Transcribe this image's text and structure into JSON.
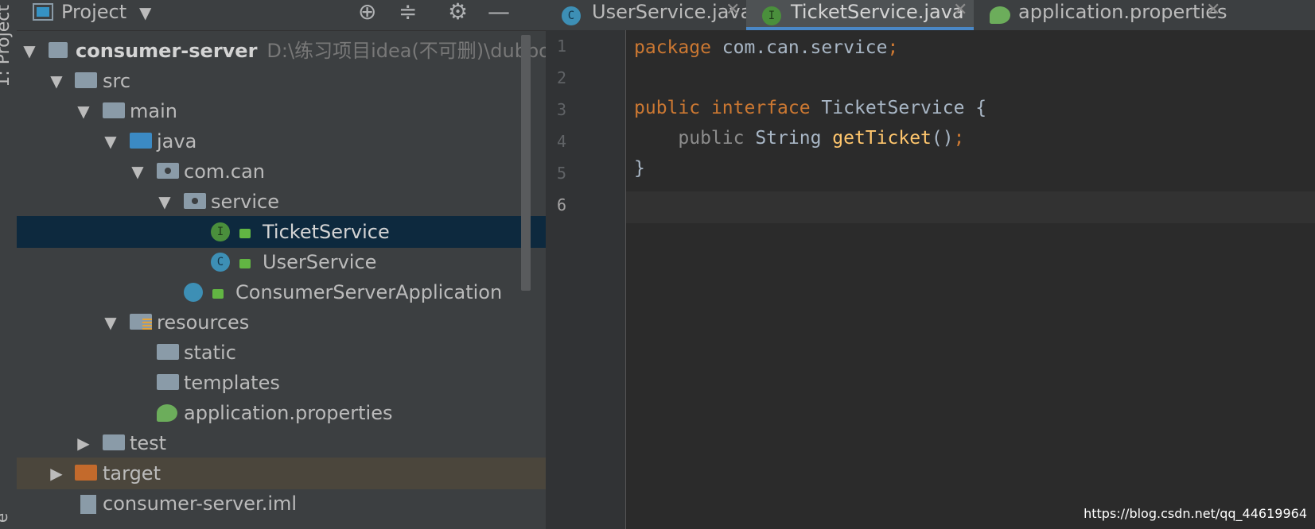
{
  "side_strip": {
    "project_label": "1: Project",
    "bottom_label": "e"
  },
  "project_panel": {
    "title": "Project",
    "tree": [
      {
        "label": "consumer-server",
        "path": "D:\\练习项目idea(不可删)\\dubbo+"
      },
      {
        "label": "src"
      },
      {
        "label": "main"
      },
      {
        "label": "java"
      },
      {
        "label": "com.can"
      },
      {
        "label": "service"
      },
      {
        "label": "TicketService",
        "icon_letter": "I"
      },
      {
        "label": "UserService",
        "icon_letter": "C"
      },
      {
        "label": "ConsumerServerApplication"
      },
      {
        "label": "resources"
      },
      {
        "label": "static"
      },
      {
        "label": "templates"
      },
      {
        "label": "application.properties"
      },
      {
        "label": "test"
      },
      {
        "label": "target"
      },
      {
        "label": "consumer-server.iml"
      }
    ]
  },
  "tabs": [
    {
      "label": "UserService.java",
      "icon_letter": "C"
    },
    {
      "label": "TicketService.java",
      "icon_letter": "I"
    },
    {
      "label": "application.properties"
    }
  ],
  "editor": {
    "line_numbers": [
      "1",
      "2",
      "3",
      "4",
      "5",
      "6"
    ],
    "lines": [
      {
        "kw": "package",
        "rest": " com.can.service",
        "semi": ";"
      },
      {},
      {
        "kw1": "public",
        "kw2": "interface",
        "rest": " TicketService {"
      },
      {
        "mod": "public",
        "type": " String ",
        "fn": "getTicket",
        "tail": "()",
        "semi": ";"
      },
      {
        "rest": "}"
      },
      {}
    ]
  },
  "watermark": "https://blog.csdn.net/qq_44619964",
  "colors": {
    "keyword": "#cc7832",
    "method": "#ffc66d",
    "selection": "#0d293e",
    "tab_accent": "#4a88c7"
  }
}
